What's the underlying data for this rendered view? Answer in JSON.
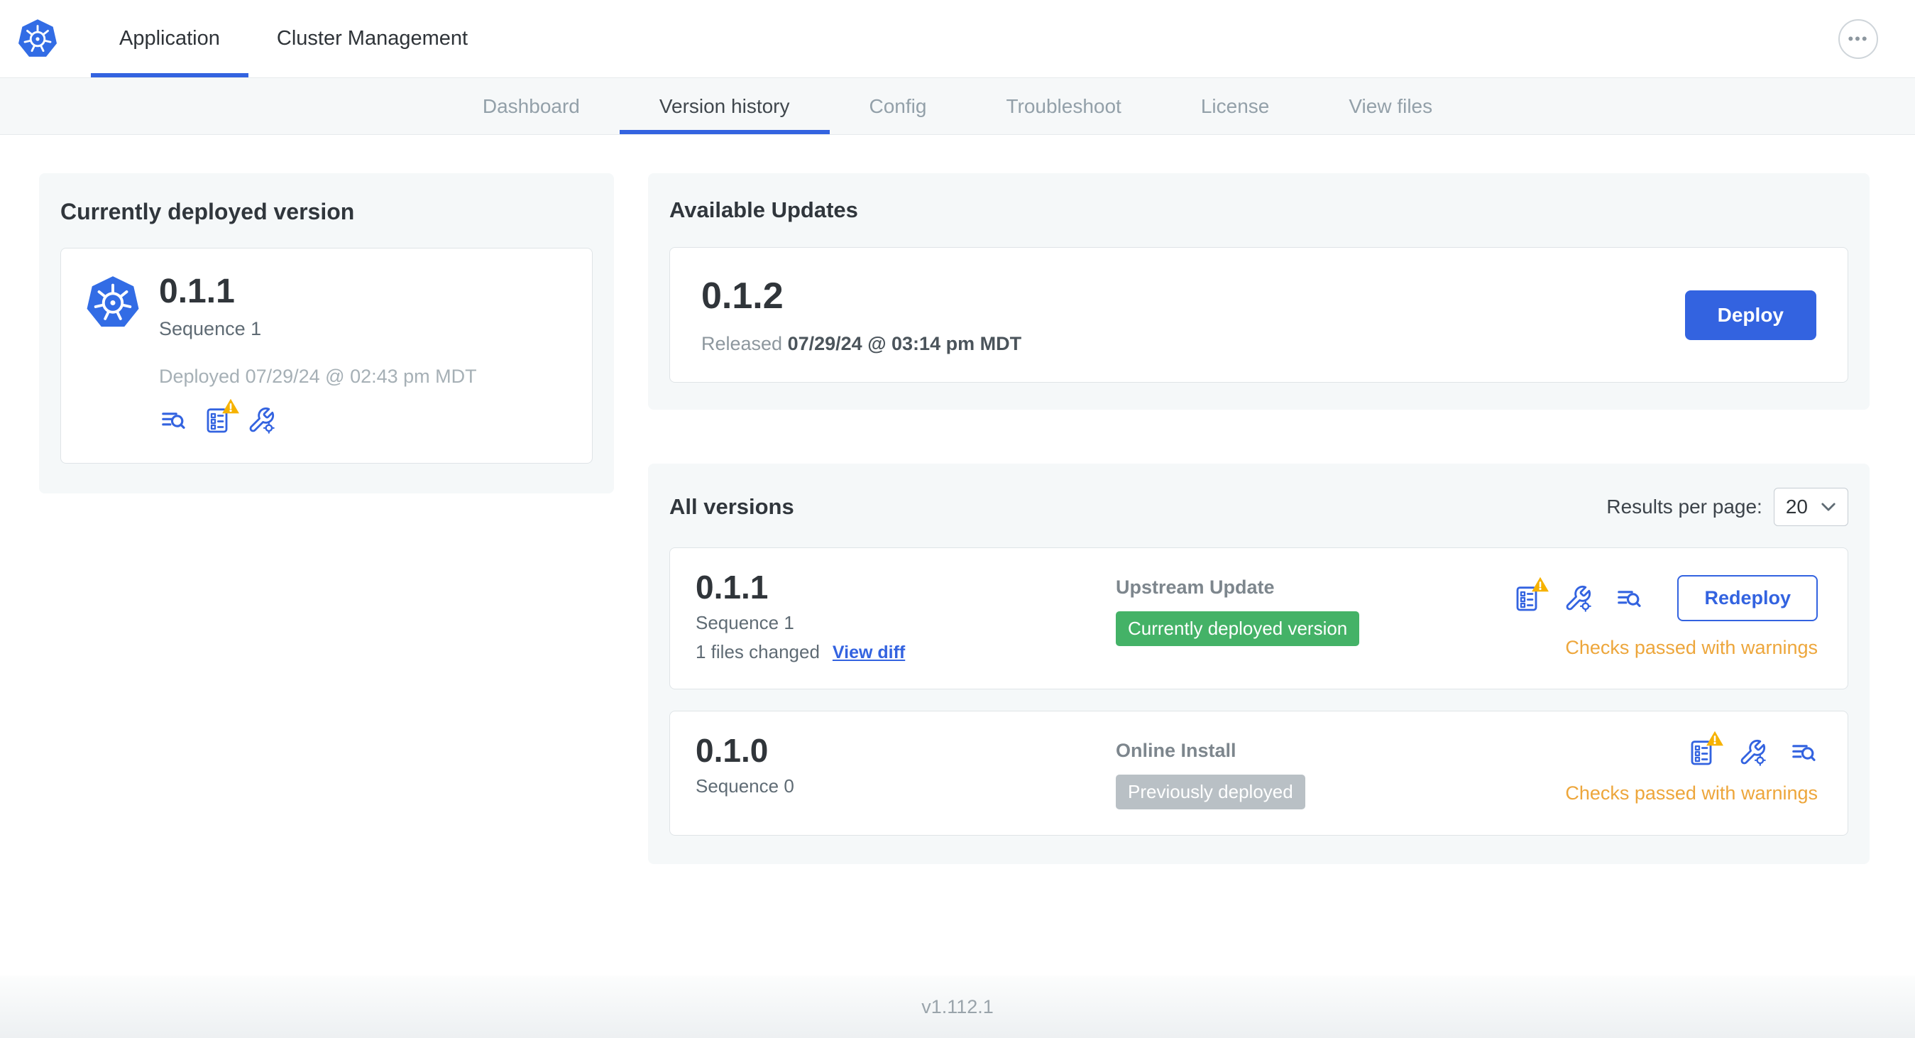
{
  "topnav": {
    "tabs": [
      {
        "label": "Application"
      },
      {
        "label": "Cluster Management"
      }
    ],
    "more_icon": "•••"
  },
  "subnav": {
    "tabs": [
      "Dashboard",
      "Version history",
      "Config",
      "Troubleshoot",
      "License",
      "View files"
    ]
  },
  "current_version": {
    "title": "Currently deployed version",
    "version": "0.1.1",
    "sequence": "Sequence 1",
    "deployed": "Deployed 07/29/24 @ 02:43 pm MDT"
  },
  "available_updates": {
    "title": "Available Updates",
    "version": "0.1.2",
    "released_label": "Released",
    "released_date": "07/29/24 @ 03:14 pm MDT",
    "deploy_button": "Deploy"
  },
  "all_versions": {
    "title": "All versions",
    "results_per_page_label": "Results per page:",
    "results_per_page_value": "20",
    "rows": [
      {
        "version": "0.1.1",
        "sequence": "Sequence 1",
        "files_changed": "1 files changed",
        "view_diff_link": "View diff",
        "source": "Upstream Update",
        "badge": "Currently deployed version",
        "badge_type": "green",
        "status": "Checks passed with warnings",
        "action_button": "Redeploy"
      },
      {
        "version": "0.1.0",
        "sequence": "Sequence 0",
        "source": "Online Install",
        "badge": "Previously deployed",
        "badge_type": "gray",
        "status": "Checks passed with warnings"
      }
    ]
  },
  "footer": {
    "version": "v1.112.1"
  },
  "icons": {
    "logo": "kubernetes-helm-logo",
    "more": "ellipsis",
    "logs": "lines-magnifier",
    "checklist": "checklist-document",
    "warning": "warning-triangle",
    "config": "wrench-gear",
    "chevron": "chevron-down"
  },
  "colors": {
    "accent_blue": "#3363e0",
    "kubernetes_blue": "#326ce5",
    "badge_green": "#44b267",
    "badge_gray": "#b9c0c5",
    "warning_text": "#eda63b",
    "warning_triangle": "#f6b200",
    "panel_bg": "#f5f8f9"
  }
}
